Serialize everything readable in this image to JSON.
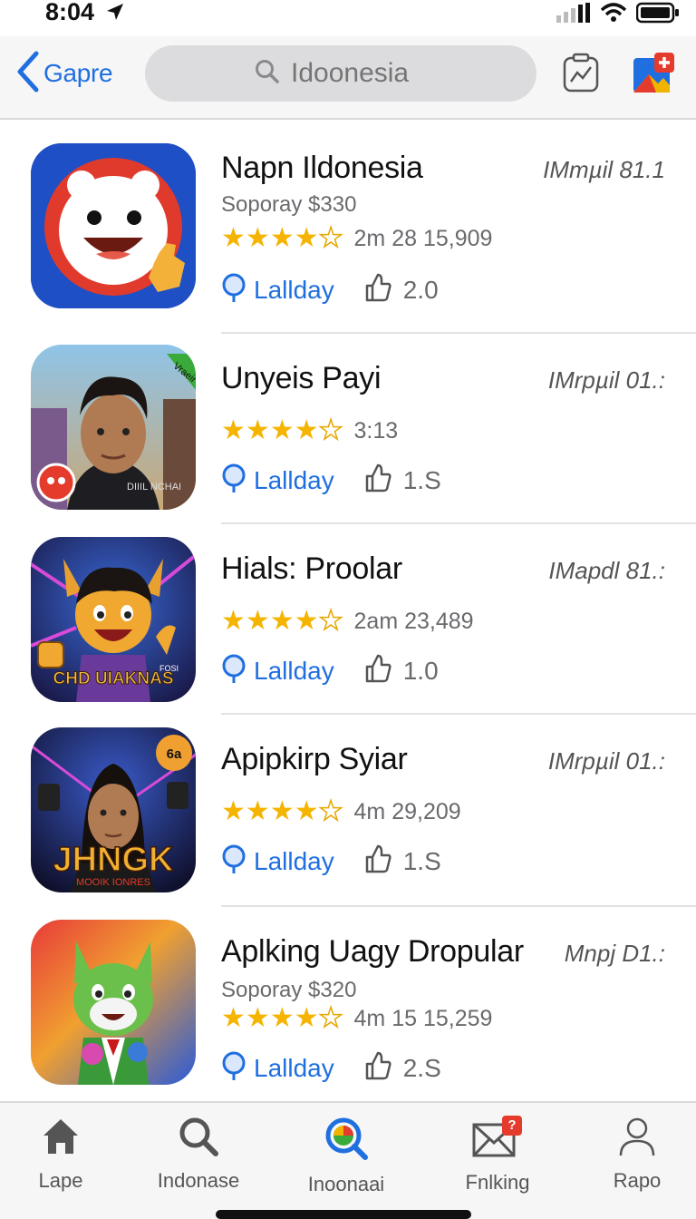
{
  "status": {
    "time": "8:04"
  },
  "nav": {
    "back_label": "Gapre",
    "search_placeholder": "Idoonesia"
  },
  "apps": [
    {
      "title": "Napn Ildonesia",
      "meta": "IMmµil 81.1",
      "price": "Soporay $330",
      "rating_value": 4.5,
      "rating_text": "2m  28  15,909",
      "get_label": "Lallday",
      "size": "2.0"
    },
    {
      "title": "Unyeis Payi",
      "meta": "IMrpµil 01.:",
      "price": "",
      "rating_value": 4.5,
      "rating_text": "3:13",
      "get_label": "Lallday",
      "size": "1.S"
    },
    {
      "title": "Hials: Proolar",
      "meta": "IMapdl 81.:",
      "price": "",
      "rating_value": 4.5,
      "rating_text": "2am  23,489",
      "get_label": "Lallday",
      "size": "1.0"
    },
    {
      "title": "Apipkirp Syiar",
      "meta": "IMrpµil 01.:",
      "price": "",
      "rating_value": 4.5,
      "rating_text": "4m  29,209",
      "get_label": "Lallday",
      "size": "1.S"
    },
    {
      "title": "Aplking Uagy Dropular",
      "meta": "Mnpj D1.:",
      "price": "Soporay $320",
      "rating_value": 4.5,
      "rating_text": "4m  15 15,259",
      "get_label": "Lallday",
      "size": "2.S"
    }
  ],
  "icons": {
    "app1": {
      "badge": ""
    },
    "app2": {
      "banner": "Vraeir",
      "caption": "DIIIL NCHAI"
    },
    "app3": {
      "caption": "CHD UIAKNAS",
      "top": "FOSI"
    },
    "app4": {
      "caption": "JHNGK",
      "sub": "MOOIK IONRES",
      "badge": "6a"
    }
  },
  "tabs": [
    {
      "label": "Lape",
      "icon": "home-icon"
    },
    {
      "label": "Indonase",
      "icon": "search-icon"
    },
    {
      "label": "Inoonaai",
      "icon": "discover-icon"
    },
    {
      "label": "Fnlking",
      "icon": "mail-icon",
      "badge": "?"
    },
    {
      "label": "Rapo",
      "icon": "profile-icon"
    }
  ],
  "colors": {
    "accent": "#1f6fe0",
    "star": "#f5b400",
    "badge": "#e53b2c"
  }
}
